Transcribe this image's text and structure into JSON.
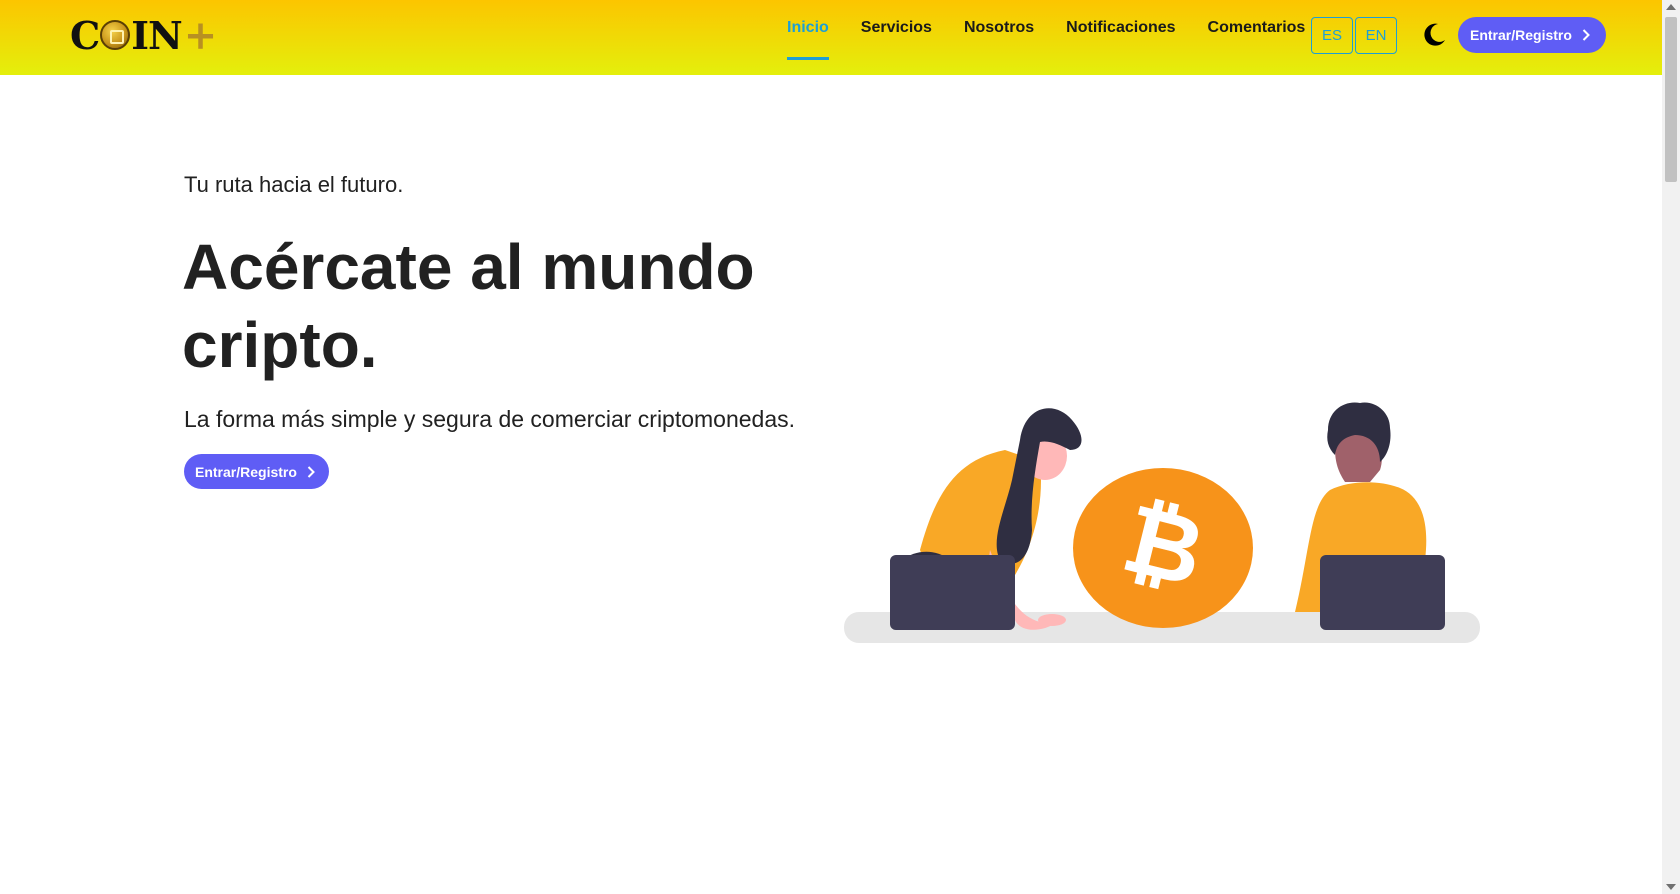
{
  "colors": {
    "brand_gradient_top": "#fcc500",
    "brand_gradient_bottom": "#e4ef0c",
    "accent": "#1d9fd6",
    "cta": "#5f5df5",
    "bitcoin_orange": "#f7931a",
    "shirt_orange": "#f9a826",
    "laptop": "#3f3d56"
  },
  "brand": {
    "logo_text_start": "C",
    "logo_text_end": "IN",
    "logo_plus": "+"
  },
  "nav": {
    "items": [
      {
        "label": "Inicio",
        "active": true
      },
      {
        "label": "Servicios",
        "active": false
      },
      {
        "label": "Nosotros",
        "active": false
      },
      {
        "label": "Notificaciones",
        "active": false
      },
      {
        "label": "Comentarios",
        "active": false
      }
    ],
    "languages": [
      "ES",
      "EN"
    ],
    "theme_toggle_icon": "moon-icon",
    "cta_label": "Entrar/Registro",
    "cta_icon": "chevron-right-icon"
  },
  "hero": {
    "kicker": "Tu ruta hacia el futuro.",
    "title": "Acércate al mundo cripto.",
    "subtitle": "La forma más simple y segura de comerciar criptomonedas.",
    "cta_label": "Entrar/Registro",
    "illustration_icon": "bitcoin-icon"
  }
}
